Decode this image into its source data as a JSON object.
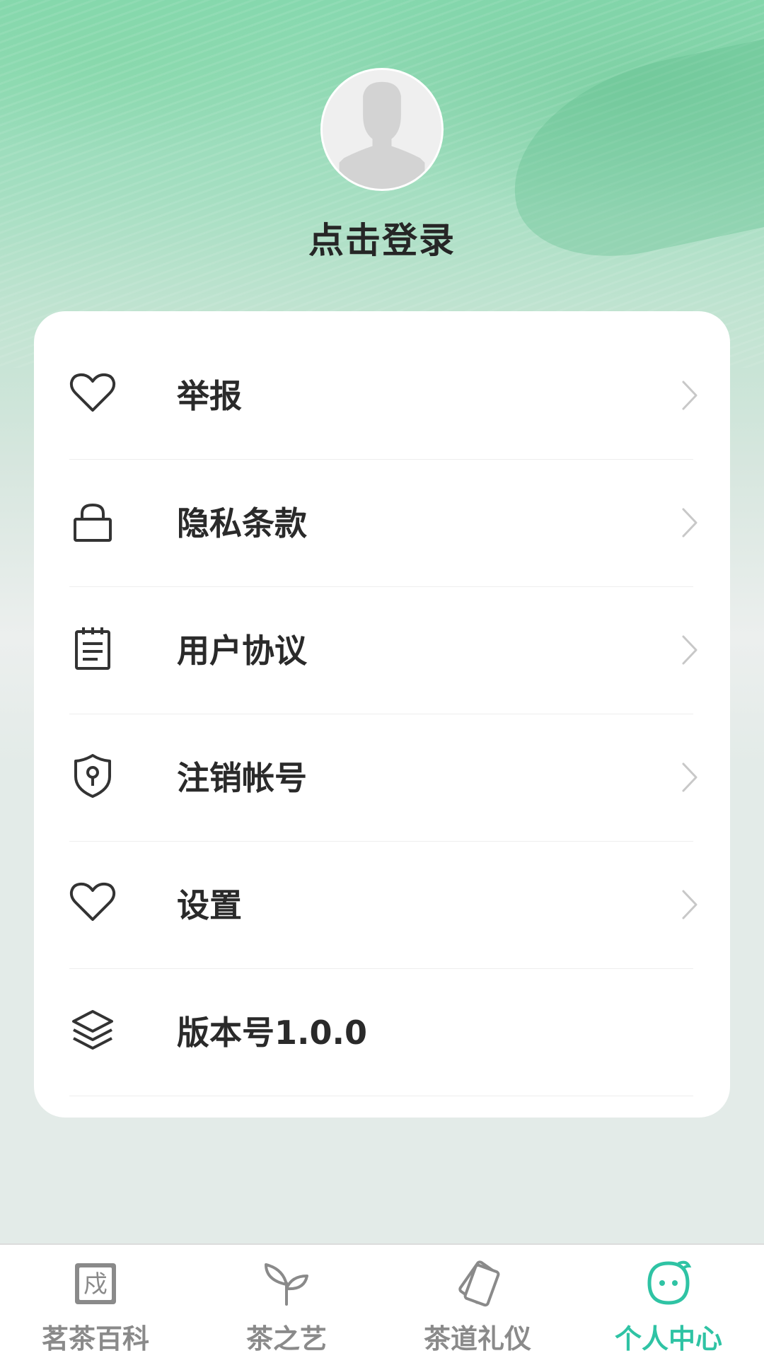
{
  "profile": {
    "login_text": "点击登录"
  },
  "menu": {
    "items": [
      {
        "label": "举报",
        "icon": "heart-icon",
        "has_chevron": true
      },
      {
        "label": "隐私条款",
        "icon": "lock-icon",
        "has_chevron": true
      },
      {
        "label": "用户协议",
        "icon": "notepad-icon",
        "has_chevron": true
      },
      {
        "label": "注销帐号",
        "icon": "shield-key-icon",
        "has_chevron": true
      },
      {
        "label": "设置",
        "icon": "heart-icon",
        "has_chevron": true
      },
      {
        "label": "版本号1.0.0",
        "icon": "layers-icon",
        "has_chevron": false
      }
    ]
  },
  "tabbar": {
    "tabs": [
      {
        "label": "茗茶百科",
        "icon": "book-stamp-icon",
        "active": false
      },
      {
        "label": "茶之艺",
        "icon": "sprout-icon",
        "active": false
      },
      {
        "label": "茶道礼仪",
        "icon": "cards-icon",
        "active": false
      },
      {
        "label": "个人中心",
        "icon": "smiley-chat-icon",
        "active": true
      }
    ],
    "tab1_icon_char": "戍"
  },
  "colors": {
    "accent": "#2fc3a4",
    "tab_inactive": "#8a8a8a",
    "text_primary": "#2a2a2a",
    "header_green": "#86d8ae",
    "page_bg": "#e3ebe8"
  }
}
